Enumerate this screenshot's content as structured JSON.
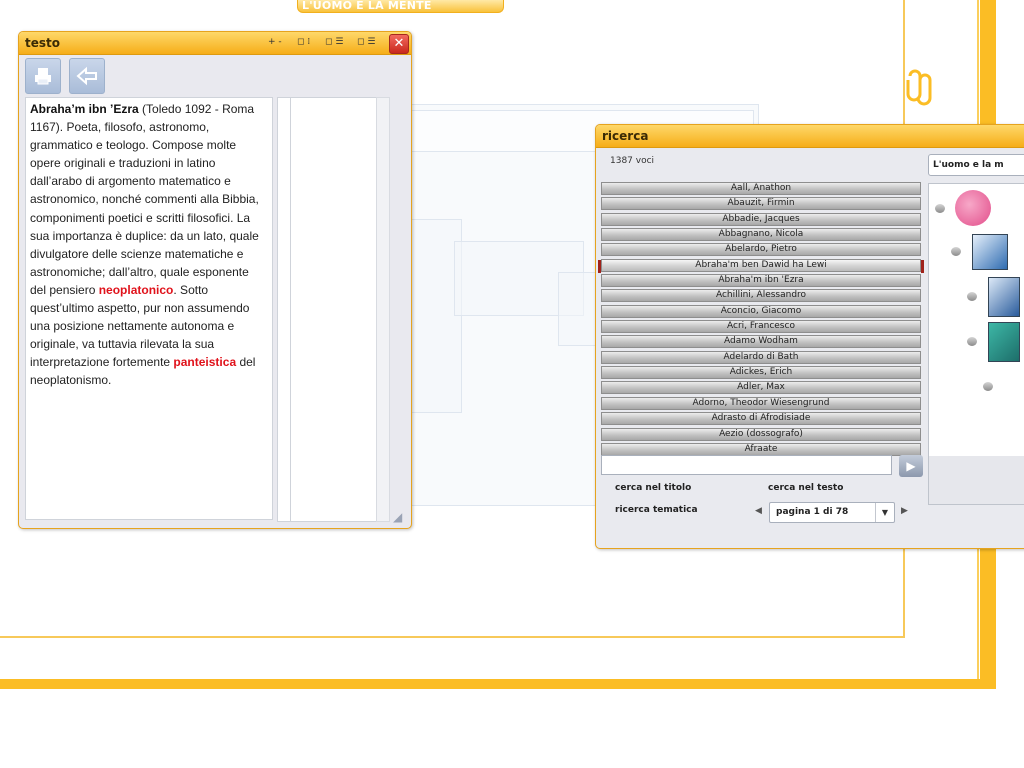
{
  "header": {
    "title": "L'UOMO E LA MENTE"
  },
  "testo": {
    "title": "testo",
    "controls": {
      "zoom": "+ -",
      "print_icon": "print-icon",
      "back_icon": "back-arrow-icon"
    },
    "text": {
      "author": "Abraha’m ibn ’Ezra",
      "p1": " (Toledo 1092 - Roma 1167). Poeta, filosofo, astronomo, grammatico e teologo. Compose molte opere originali e traduzioni in latino dall’arabo di argomento matematico e astronomico, nonché commenti alla Bibbia, componimenti poetici e scritti filosofici. La sua importanza è duplice: da un lato, quale divulgatore delle scienze matematiche e astronomiche; dall’altro, quale esponente del pensiero ",
      "hl1": "neoplatonico",
      "p2": ". Sotto quest’ultimo aspetto, pur non assumendo una posizione nettamente autonoma e originale, va tuttavia rilevata la sua interpretazione fortemente ",
      "hl2": "panteistica",
      "p3": " del neoplatonismo."
    },
    "colors": {
      "highlight": "#e0121b",
      "titlebar": "#f6ad18"
    }
  },
  "ricerca": {
    "title": "ricerca",
    "count": "1387 voci",
    "theme_select": "L'uomo e la m",
    "items": [
      "Aall, Anathon",
      "Abauzit, Firmin",
      "Abbadie, Jacques",
      "Abbagnano, Nicola",
      "Abelardo, Pietro",
      "Abraha'm ben Dawid ha Lewi",
      "Abraha'm ibn 'Ezra",
      "Achillini, Alessandro",
      "Aconcio, Giacomo",
      "Acri, Francesco",
      "Adamo Wodham",
      "Adelardo di Bath",
      "Adickes, Erich",
      "Adler, Max",
      "Adorno, Theodor Wiesengrund",
      "Adrasto di Afrodisiade",
      "Aezio (dossografo)",
      "Afraate"
    ],
    "search_value": "",
    "links": {
      "title": "cerca nel titolo",
      "text": "cerca nel testo",
      "thematic": "ricerca tematica"
    },
    "pager": {
      "label": "pagina 1 di 78"
    }
  }
}
